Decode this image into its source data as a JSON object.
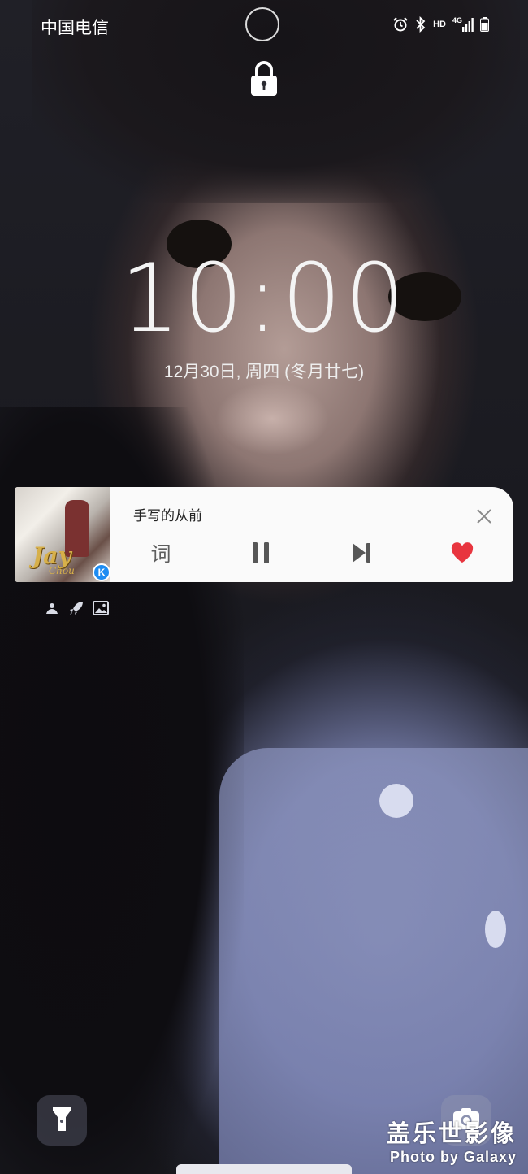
{
  "status_bar": {
    "carrier": "中国电信",
    "hd": "HD",
    "network": "4G",
    "icons": [
      "alarm-icon",
      "bluetooth-icon",
      "signal-icon",
      "battery-icon"
    ]
  },
  "lock_screen": {
    "time": "10:00",
    "date": "12月30日, 周四 (冬月廿七)"
  },
  "music_widget": {
    "song_title": "手写的从前",
    "lyrics_label": "词",
    "album_cover_text": "Jay",
    "album_cover_subtext": "Chou",
    "app_badge": "K",
    "liked": true,
    "accent_color": "#e8353f"
  },
  "shortcut_icons": [
    "app-icon",
    "rocket-icon",
    "image-icon"
  ],
  "bottom": {
    "left_shortcut": "flashlight-icon",
    "right_shortcut": "camera-icon"
  },
  "watermark": {
    "title": "盖乐世影像",
    "subtitle": "Photo by Galaxy"
  }
}
